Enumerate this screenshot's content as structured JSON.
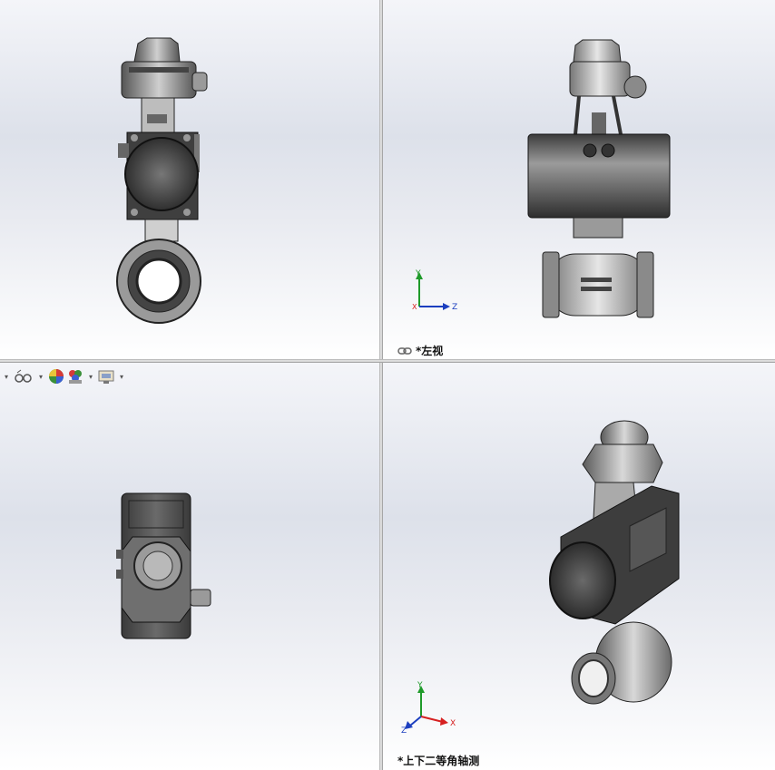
{
  "viewports": {
    "top_left": {
      "label": ""
    },
    "top_right": {
      "label": "*左视",
      "link_icon": "link-icon"
    },
    "bottom_left": {
      "label": ""
    },
    "bottom_right": {
      "label": "*上下二等角轴测"
    }
  },
  "triad": {
    "x": "X",
    "y": "Y",
    "z": "Z"
  },
  "toolbar": {
    "items": [
      {
        "icon": "view-orientation-icon"
      },
      {
        "icon": "display-style-icon"
      },
      {
        "icon": "appearance-icon"
      },
      {
        "icon": "scene-icon"
      },
      {
        "icon": "view-settings-icon"
      }
    ]
  },
  "colors": {
    "viewport_top": "#f4f5f9",
    "viewport_bottom": "#ffffff",
    "model_dark": "#4a4a4a",
    "model_mid": "#8c8c8c",
    "model_light": "#d2d2d2",
    "axis_x": "#d62020",
    "axis_y": "#1f9a2a",
    "axis_z": "#1c3fbf"
  }
}
